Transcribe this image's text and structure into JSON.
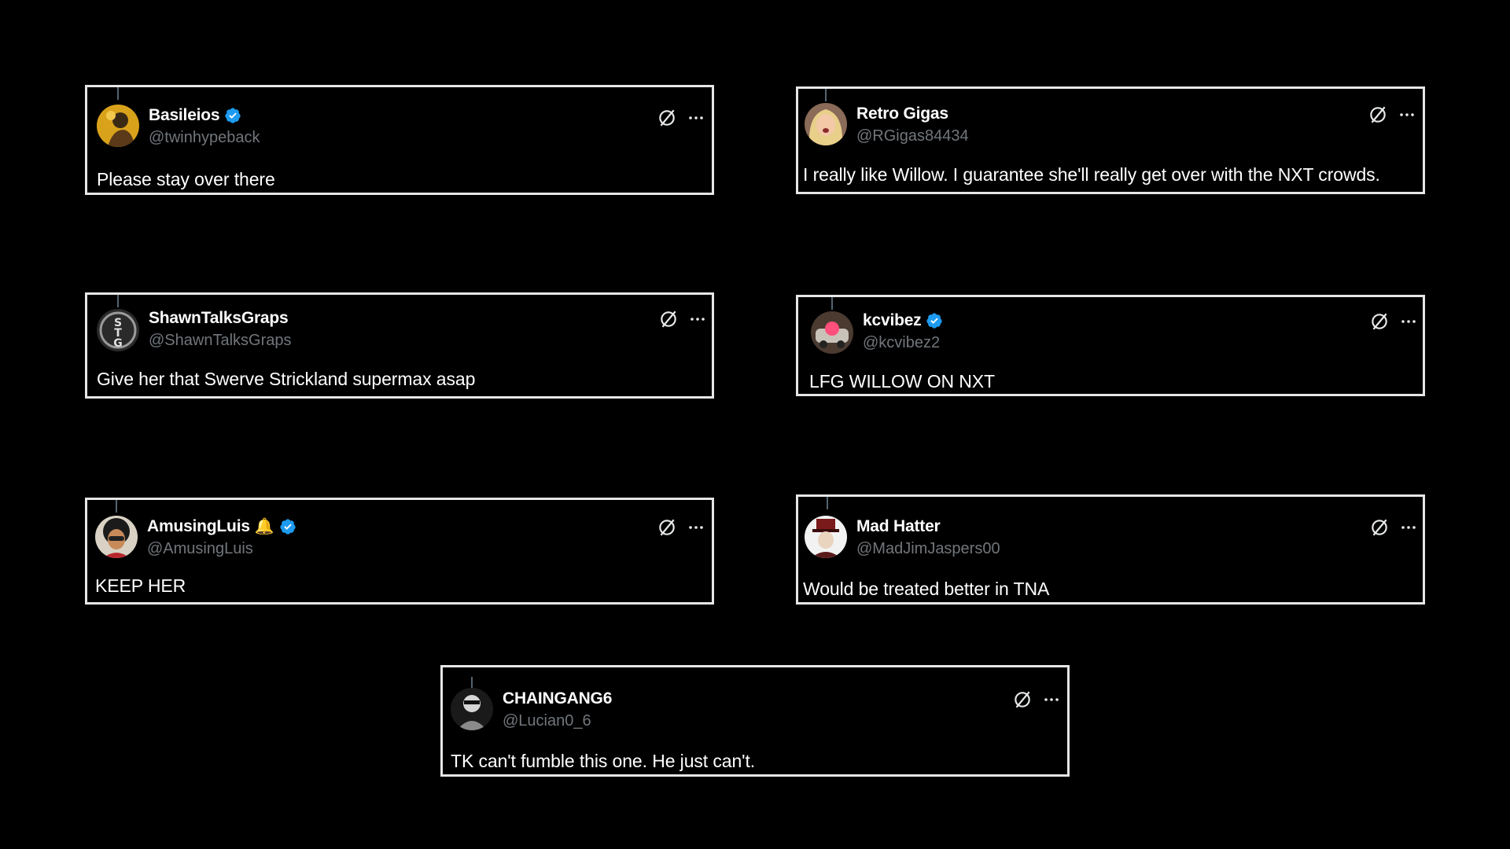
{
  "theme": {
    "background": "#000000",
    "card_border": "#e6e6e6",
    "name_color": "#ffffff",
    "handle_color": "#71767b",
    "verified_color": "#1d9bf0"
  },
  "tweets": [
    {
      "display_name": "Basileios",
      "handle": "@twinhypeback",
      "verified": true,
      "text": "Please stay over there",
      "avatar": "avatar-gold-figure",
      "action_icons": [
        "grok-icon",
        "more-icon"
      ]
    },
    {
      "display_name": "Retro Gigas",
      "handle": "@RGigas84434",
      "verified": false,
      "text": "I really like Willow. I guarantee she'll really get over with the NXT crowds.",
      "avatar": "avatar-blonde-woman",
      "action_icons": [
        "grok-icon",
        "more-icon"
      ]
    },
    {
      "display_name": "ShawnTalksGraps",
      "handle": "@ShawnTalksGraps",
      "verified": false,
      "text": "Give her that Swerve Strickland supermax asap",
      "avatar": "avatar-stg-logo",
      "action_icons": [
        "grok-icon",
        "more-icon"
      ]
    },
    {
      "display_name": "kcvibez",
      "handle": "@kcvibez2",
      "verified": true,
      "text": "LFG WILLOW ON NXT",
      "avatar": "avatar-car-pink",
      "action_icons": [
        "grok-icon",
        "more-icon"
      ]
    },
    {
      "display_name": "AmusingLuis",
      "handle": "@AmusingLuis",
      "verified": true,
      "badge_emoji": "🔔",
      "text": "KEEP HER",
      "avatar": "avatar-cartoon-afro",
      "action_icons": [
        "grok-icon",
        "more-icon"
      ]
    },
    {
      "display_name": "Mad Hatter",
      "handle": "@MadJimJaspers00",
      "verified": false,
      "text": "Would be treated better in TNA",
      "avatar": "avatar-mad-hatter",
      "action_icons": [
        "grok-icon",
        "more-icon"
      ]
    },
    {
      "display_name": "CHAINGANG6",
      "handle": "@Lucian0_6",
      "verified": false,
      "text": "TK can't fumble this one. He just can't.",
      "avatar": "avatar-bw-figure",
      "action_icons": [
        "grok-icon",
        "more-icon"
      ]
    }
  ]
}
